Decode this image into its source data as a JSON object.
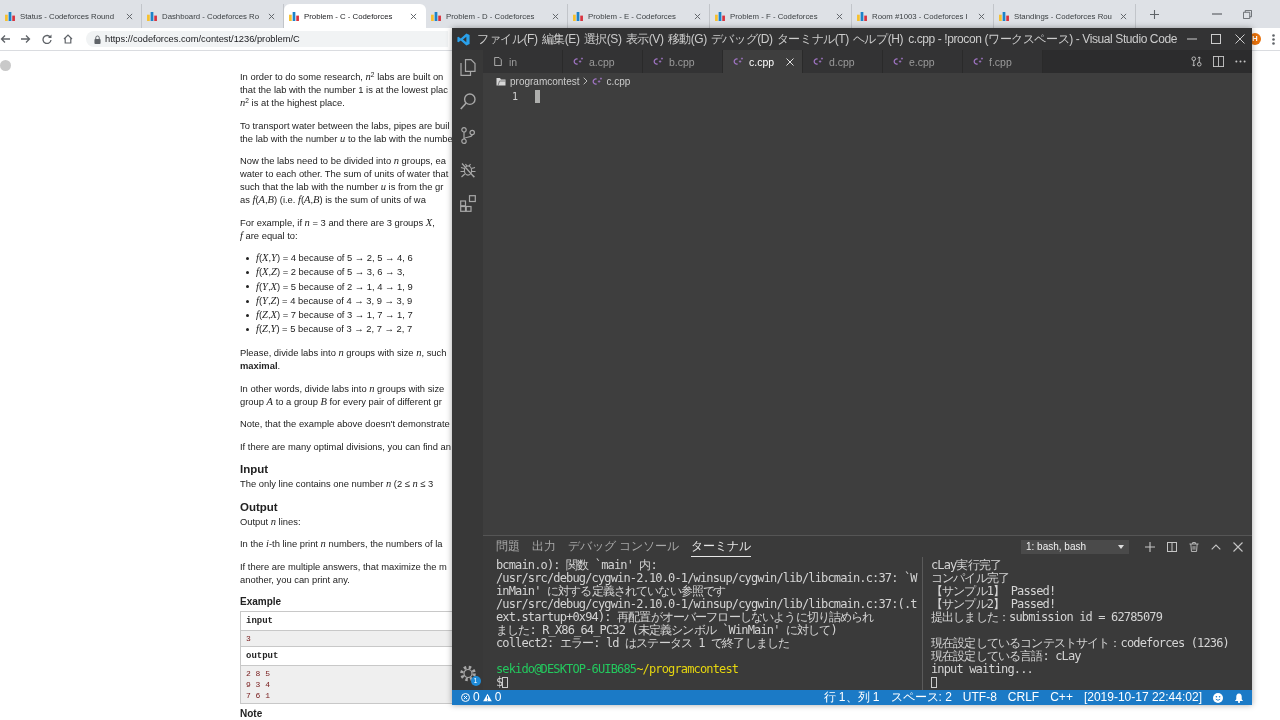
{
  "browser": {
    "tabs": [
      {
        "title": "Status - Codeforces Round",
        "selected": false
      },
      {
        "title": "Dashboard - Codeforces Ro",
        "selected": false
      },
      {
        "title": "Problem - C - Codeforces",
        "selected": true
      },
      {
        "title": "Problem - D - Codeforces",
        "selected": false
      },
      {
        "title": "Problem - E - Codeforces",
        "selected": false
      },
      {
        "title": "Problem - F - Codeforces",
        "selected": false
      },
      {
        "title": "Room #1003 - Codeforces I",
        "selected": false
      },
      {
        "title": "Standings - Codeforces Rou",
        "selected": false
      }
    ],
    "url": "https://codeforces.com/contest/1236/problem/C",
    "profile_initial": "H"
  },
  "problem": {
    "statement": [
      {
        "kind": "paragraph",
        "lines": [
          "In order to do some research, *n*$^{2}$ labs are built on",
          "that the lab with the number 1 is at the lowest plac",
          "*n*$^{2}$ is at the highest place."
        ]
      },
      {
        "kind": "paragraph",
        "lines": [
          "To transport water between the labs, pipes are buil",
          "the lab with the number *u* to the lab with the numbe"
        ]
      },
      {
        "kind": "paragraph",
        "lines": [
          "Now the labs need to be divided into *n* groups, ea",
          "water to each other. The sum of units of water that",
          "such that the lab with the number *u* is from the gr",
          "as *f*(*A*,*B*) (i.e. *f*(*A*,*B*) is the sum of units of wa"
        ]
      },
      {
        "kind": "paragraph",
        "lines": [
          "For example, if *n* = 3 and there are 3 groups *X*,",
          "*f* are equal to:"
        ]
      },
      {
        "kind": "list",
        "items": [
          "*f*(*X*,*Y*) = 4 because of 5 → 2, 5 → 4, 6",
          "*f*(*X*,*Z*) = 2 because of 5 → 3, 6 → 3,",
          "*f*(*Y*,*X*) = 5 because of 2 → 1, 4 → 1, 9",
          "*f*(*Y*,*Z*) = 4 because of 4 → 3, 9 → 3, 9",
          "*f*(*Z*,*X*) = 7 because of 3 → 1, 7 → 1, 7",
          "*f*(*Z*,*Y*) = 5 because of 3 → 2, 7 → 2, 7"
        ]
      },
      {
        "kind": "paragraph",
        "lines": [
          "Please, divide labs into *n* groups with size *n*, such",
          "**maximal**."
        ]
      },
      {
        "kind": "paragraph",
        "lines": [
          "In other words, divide labs into *n* groups with size",
          "group *A* to a group *B* for every pair of different gr"
        ]
      },
      {
        "kind": "paragraph",
        "lines": [
          "Note, that the example above doesn't demonstrate"
        ]
      },
      {
        "kind": "paragraph",
        "lines": [
          "If there are many optimal divisions, you can find an"
        ]
      }
    ],
    "input": {
      "title": "Input",
      "paragraphs": [
        {
          "lines": [
            "The only line contains one number *n* (2 ≤ *n* ≤ 3"
          ]
        }
      ]
    },
    "output": {
      "title": "Output",
      "paragraphs": [
        {
          "lines": [
            "Output *n* lines:"
          ]
        },
        {
          "lines": [
            "In the *i*-th line print *n* numbers, the numbers of la"
          ]
        },
        {
          "lines": [
            "If there are multiple answers, that maximize the m",
            "another, you can print any."
          ]
        }
      ]
    },
    "example": {
      "title": "Example",
      "blocks": [
        {
          "header": "input",
          "lines": [
            "3"
          ]
        },
        {
          "header": "output",
          "lines": [
            "2 8 5",
            "9 3 4",
            "7 6 1"
          ]
        }
      ]
    },
    "note": {
      "title": "Note"
    }
  },
  "vscode": {
    "menu": [
      "ファイル(F)",
      "編集(E)",
      "選択(S)",
      "表示(V)",
      "移動(G)",
      "デバッグ(D)",
      "ターミナル(T)",
      "ヘルプ(H)"
    ],
    "title": "c.cpp - !procon (ワークスペース) - Visual Studio Code",
    "settings_badge": "1",
    "tabs": [
      {
        "label": "in",
        "kind": "file",
        "selected": false
      },
      {
        "label": "a.cpp",
        "kind": "cpp",
        "selected": false
      },
      {
        "label": "b.cpp",
        "kind": "cpp",
        "selected": false
      },
      {
        "label": "c.cpp",
        "kind": "cpp",
        "selected": true
      },
      {
        "label": "d.cpp",
        "kind": "cpp",
        "selected": false
      },
      {
        "label": "e.cpp",
        "kind": "cpp",
        "selected": false
      },
      {
        "label": "f.cpp",
        "kind": "cpp",
        "selected": false
      }
    ],
    "breadcrumbs": [
      {
        "label": "programcontest",
        "kind": "folder"
      },
      {
        "label": "c.cpp",
        "kind": "cpp"
      }
    ],
    "line_numbers": [
      "1"
    ],
    "panel_tabs": [
      {
        "label": "問題",
        "selected": false
      },
      {
        "label": "出力",
        "selected": false
      },
      {
        "label": "デバッグ コンソール",
        "selected": false
      },
      {
        "label": "ターミナル",
        "selected": true
      }
    ],
    "terminal_select": "1: bash, bash",
    "terminals": [
      {
        "lines": [
          {
            "kind": "text",
            "text": "bcmain.o): 関数 `main' 内:"
          },
          {
            "kind": "text",
            "text": "/usr/src/debug/cygwin-2.10.0-1/winsup/cygwin/lib/libcmain.c:37: `W"
          },
          {
            "kind": "text",
            "text": "inMain' に対する定義されていない参照です"
          },
          {
            "kind": "text",
            "text": "/usr/src/debug/cygwin-2.10.0-1/winsup/cygwin/lib/libcmain.c:37:(.t"
          },
          {
            "kind": "text",
            "text": "ext.startup+0x94): 再配置がオーバーフローしないように切り詰められ"
          },
          {
            "kind": "text",
            "text": "ました: R_X86_64_PC32 (未定義シンボル `WinMain' に対して)"
          },
          {
            "kind": "text",
            "text": "collect2: エラー: ld はステータス 1 で終了しました"
          },
          {
            "kind": "blank"
          },
          {
            "kind": "prompt",
            "user": "sekido@DESKTOP-6UIB685",
            "path": "~/programcontest"
          },
          {
            "kind": "input",
            "text": "$"
          }
        ]
      },
      {
        "lines": [
          {
            "kind": "text",
            "text": "cLay実行完了"
          },
          {
            "kind": "text",
            "text": "コンパイル完了"
          },
          {
            "kind": "text",
            "text": "【サンプル1】 Passed!"
          },
          {
            "kind": "text",
            "text": "【サンプル2】 Passed!"
          },
          {
            "kind": "text",
            "text": "提出しました：submission id = 62785079"
          },
          {
            "kind": "blank"
          },
          {
            "kind": "text",
            "text": "現在設定しているコンテストサイト：codeforces (1236)"
          },
          {
            "kind": "text",
            "text": "現在設定している言語: cLay"
          },
          {
            "kind": "text",
            "text": "input waiting..."
          },
          {
            "kind": "cursor"
          }
        ]
      }
    ],
    "status": {
      "errors": "0",
      "warnings": "0",
      "items": [
        "行 1、列 1",
        "スペース: 2",
        "UTF-8",
        "CRLF",
        "C++",
        "[2019-10-17 22:44:02]"
      ]
    }
  }
}
